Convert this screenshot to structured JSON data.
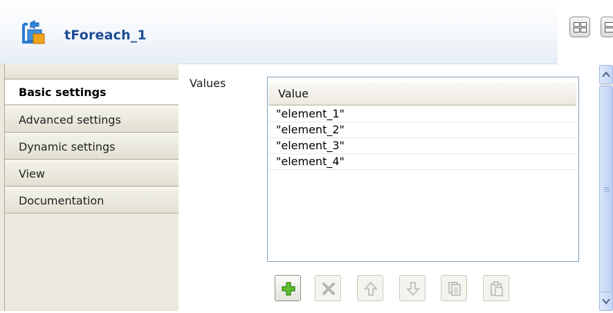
{
  "header": {
    "title": "tForeach_1",
    "icon": "foreach-component-icon",
    "accent": "#1c4d94"
  },
  "tabs": [
    {
      "label": "Basic settings",
      "active": true
    },
    {
      "label": "Advanced settings",
      "active": false
    },
    {
      "label": "Dynamic settings",
      "active": false
    },
    {
      "label": "View",
      "active": false
    },
    {
      "label": "Documentation",
      "active": false
    }
  ],
  "main": {
    "values_label": "Values",
    "table": {
      "column": "Value",
      "rows": [
        "\"element_1\"",
        "\"element_2\"",
        "\"element_3\"",
        "\"element_4\""
      ]
    }
  },
  "toolbar": {
    "buttons": [
      {
        "name": "add-button",
        "icon": "plus-icon",
        "enabled": true
      },
      {
        "name": "remove-button",
        "icon": "delete-icon",
        "enabled": false
      },
      {
        "name": "move-up-button",
        "icon": "arrow-up-icon",
        "enabled": false
      },
      {
        "name": "move-down-button",
        "icon": "arrow-down-icon",
        "enabled": false
      },
      {
        "name": "copy-button",
        "icon": "copy-icon",
        "enabled": false
      },
      {
        "name": "paste-button",
        "icon": "paste-icon",
        "enabled": false
      }
    ]
  }
}
